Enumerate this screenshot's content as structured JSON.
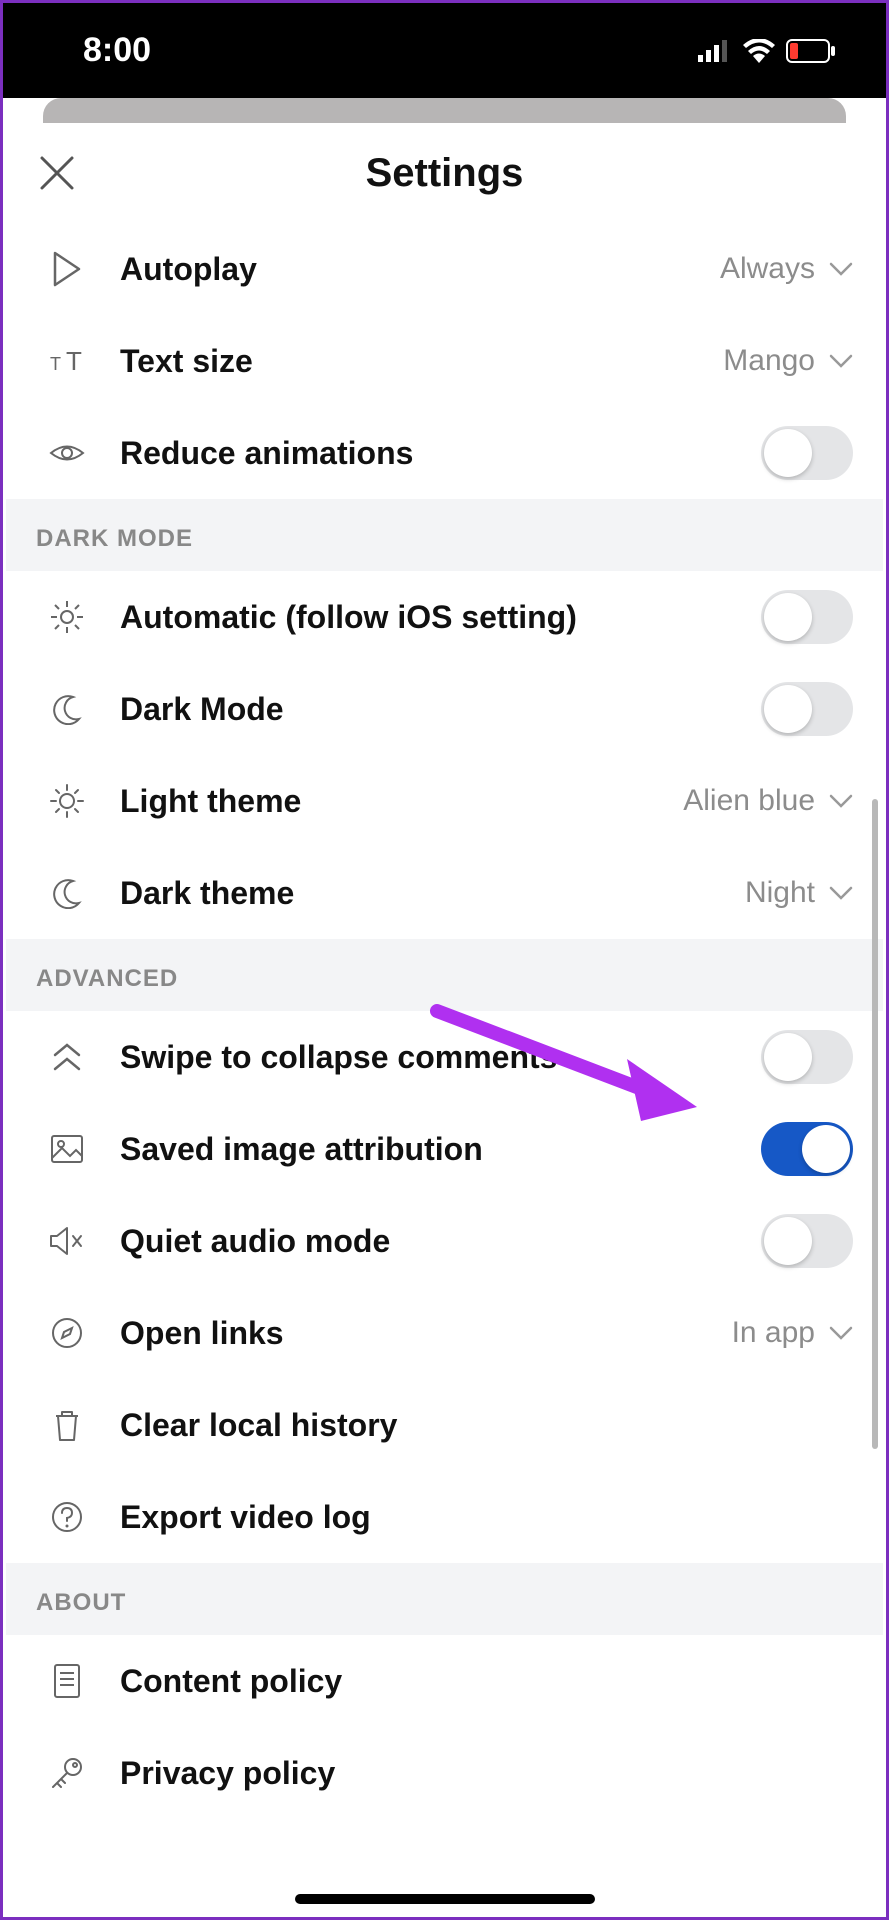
{
  "status": {
    "time": "8:00"
  },
  "header": {
    "title": "Settings"
  },
  "sections": {
    "top": {
      "autoplay": {
        "label": "Autoplay",
        "value": "Always"
      },
      "textsize": {
        "label": "Text size",
        "value": "Mango"
      },
      "reduce": {
        "label": "Reduce animations"
      }
    },
    "dark": {
      "title": "DARK MODE",
      "auto": {
        "label": "Automatic (follow iOS setting)"
      },
      "dark": {
        "label": "Dark Mode"
      },
      "light": {
        "label": "Light theme",
        "value": "Alien blue"
      },
      "dtheme": {
        "label": "Dark theme",
        "value": "Night"
      }
    },
    "adv": {
      "title": "ADVANCED",
      "swipe": {
        "label": "Swipe to collapse comments"
      },
      "saved": {
        "label": "Saved image attribution"
      },
      "quiet": {
        "label": "Quiet audio mode"
      },
      "open": {
        "label": "Open links",
        "value": "In app"
      },
      "clear": {
        "label": "Clear local history"
      },
      "export": {
        "label": "Export video log"
      }
    },
    "about": {
      "title": "ABOUT",
      "content": {
        "label": "Content policy"
      },
      "privacy": {
        "label": "Privacy policy"
      }
    }
  }
}
